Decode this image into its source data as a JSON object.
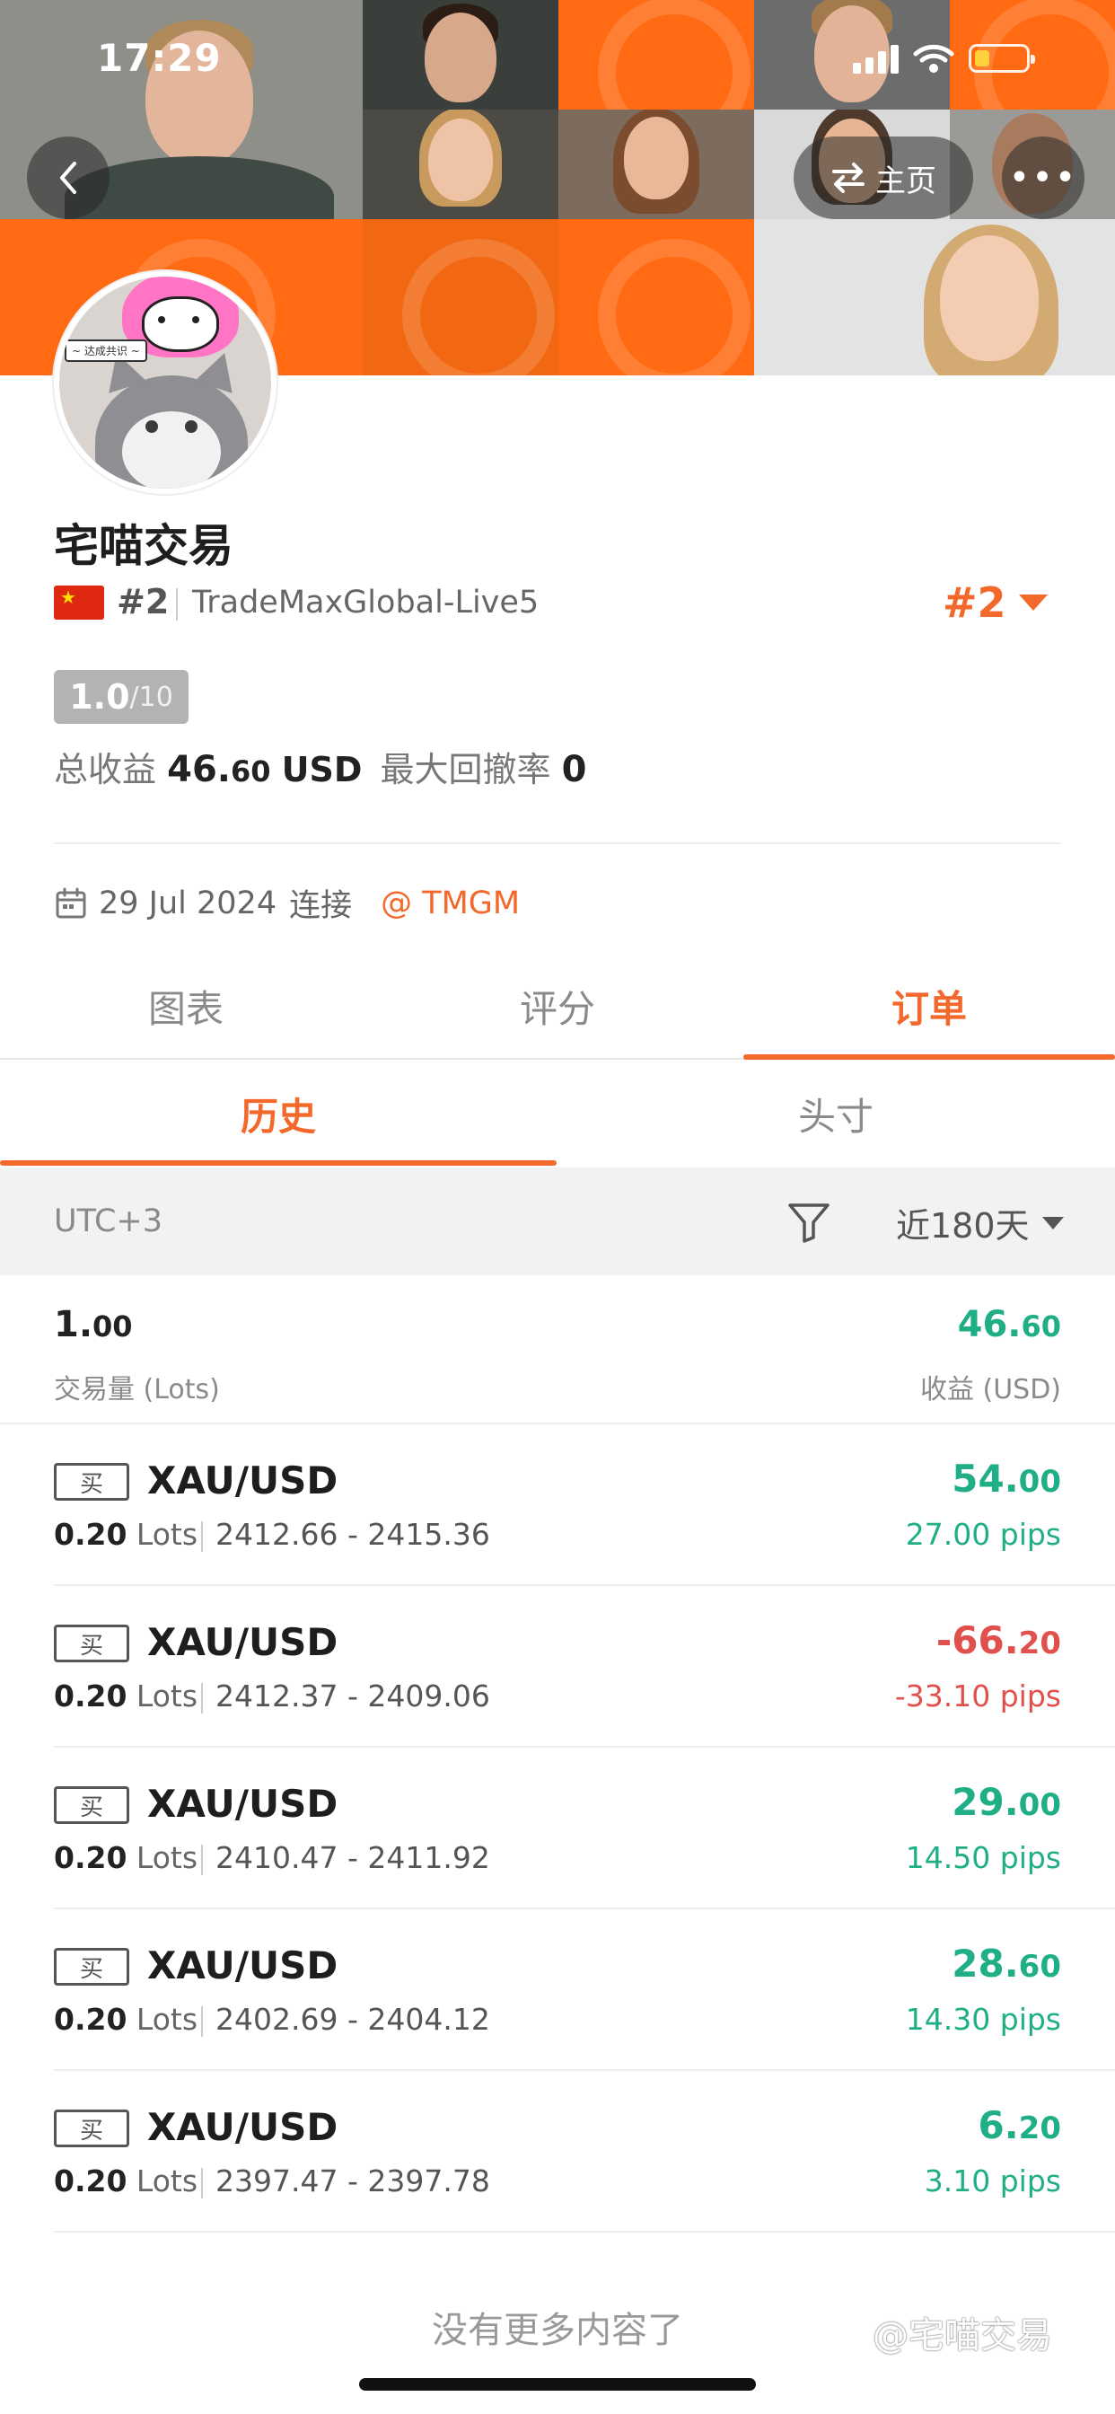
{
  "status_bar": {
    "time": "17:29"
  },
  "header": {
    "home_label": "主页",
    "more_label": "•••"
  },
  "avatar": {
    "caption": "~ 达成共识 ~"
  },
  "profile": {
    "name": "宅喵交易",
    "rank_small": "#2",
    "server": "TradeMaxGlobal-Live5",
    "rank_right": "#2",
    "score_main": "1.0",
    "score_max": "/10",
    "total_profit_label": "总收益",
    "total_profit_int": "46.",
    "total_profit_dec": "60",
    "total_profit_unit": "USD",
    "max_drawdown_label": "最大回撤率",
    "max_drawdown_value": "0",
    "connect_date": "29 Jul 2024",
    "connect_label": "连接",
    "broker": "@ TMGM"
  },
  "main_tabs": [
    {
      "label": "图表"
    },
    {
      "label": "评分"
    },
    {
      "label": "订单"
    }
  ],
  "sub_tabs": [
    {
      "label": "历史"
    },
    {
      "label": "头寸"
    }
  ],
  "filter": {
    "timezone": "UTC+3",
    "period": "近180天"
  },
  "summary": {
    "volume_int": "1.",
    "volume_dec": "00",
    "volume_label": "交易量 (Lots)",
    "profit_int": "46.",
    "profit_dec": "60",
    "profit_label": "收益 (USD)"
  },
  "orders": [
    {
      "side": "买",
      "symbol": "XAU/USD",
      "lots": "0.20",
      "lots_unit": "Lots",
      "prices": "2412.66 - 2415.36",
      "profit_int": "54.",
      "profit_dec": "00",
      "pips": "27.00 pips",
      "positive": true
    },
    {
      "side": "买",
      "symbol": "XAU/USD",
      "lots": "0.20",
      "lots_unit": "Lots",
      "prices": "2412.37 - 2409.06",
      "profit_int": "-66.",
      "profit_dec": "20",
      "pips": "-33.10 pips",
      "positive": false
    },
    {
      "side": "买",
      "symbol": "XAU/USD",
      "lots": "0.20",
      "lots_unit": "Lots",
      "prices": "2410.47 - 2411.92",
      "profit_int": "29.",
      "profit_dec": "00",
      "pips": "14.50 pips",
      "positive": true
    },
    {
      "side": "买",
      "symbol": "XAU/USD",
      "lots": "0.20",
      "lots_unit": "Lots",
      "prices": "2402.69 - 2404.12",
      "profit_int": "28.",
      "profit_dec": "60",
      "pips": "14.30 pips",
      "positive": true
    },
    {
      "side": "买",
      "symbol": "XAU/USD",
      "lots": "0.20",
      "lots_unit": "Lots",
      "prices": "2397.47 - 2397.78",
      "profit_int": "6.",
      "profit_dec": "20",
      "pips": "3.10 pips",
      "positive": true
    }
  ],
  "footer": {
    "no_more": "没有更多内容了",
    "watermark": "@宅喵交易"
  },
  "colors": {
    "accent": "#f2692b",
    "profit": "#1fae86",
    "loss": "#e0504d",
    "banner_orange": "#ff6a13"
  },
  "icons": [
    "back-chevron-icon",
    "switch-arrows-icon",
    "more-dots-icon",
    "calendar-icon",
    "filter-funnel-icon",
    "caret-down-icon",
    "flag-cn-icon"
  ]
}
